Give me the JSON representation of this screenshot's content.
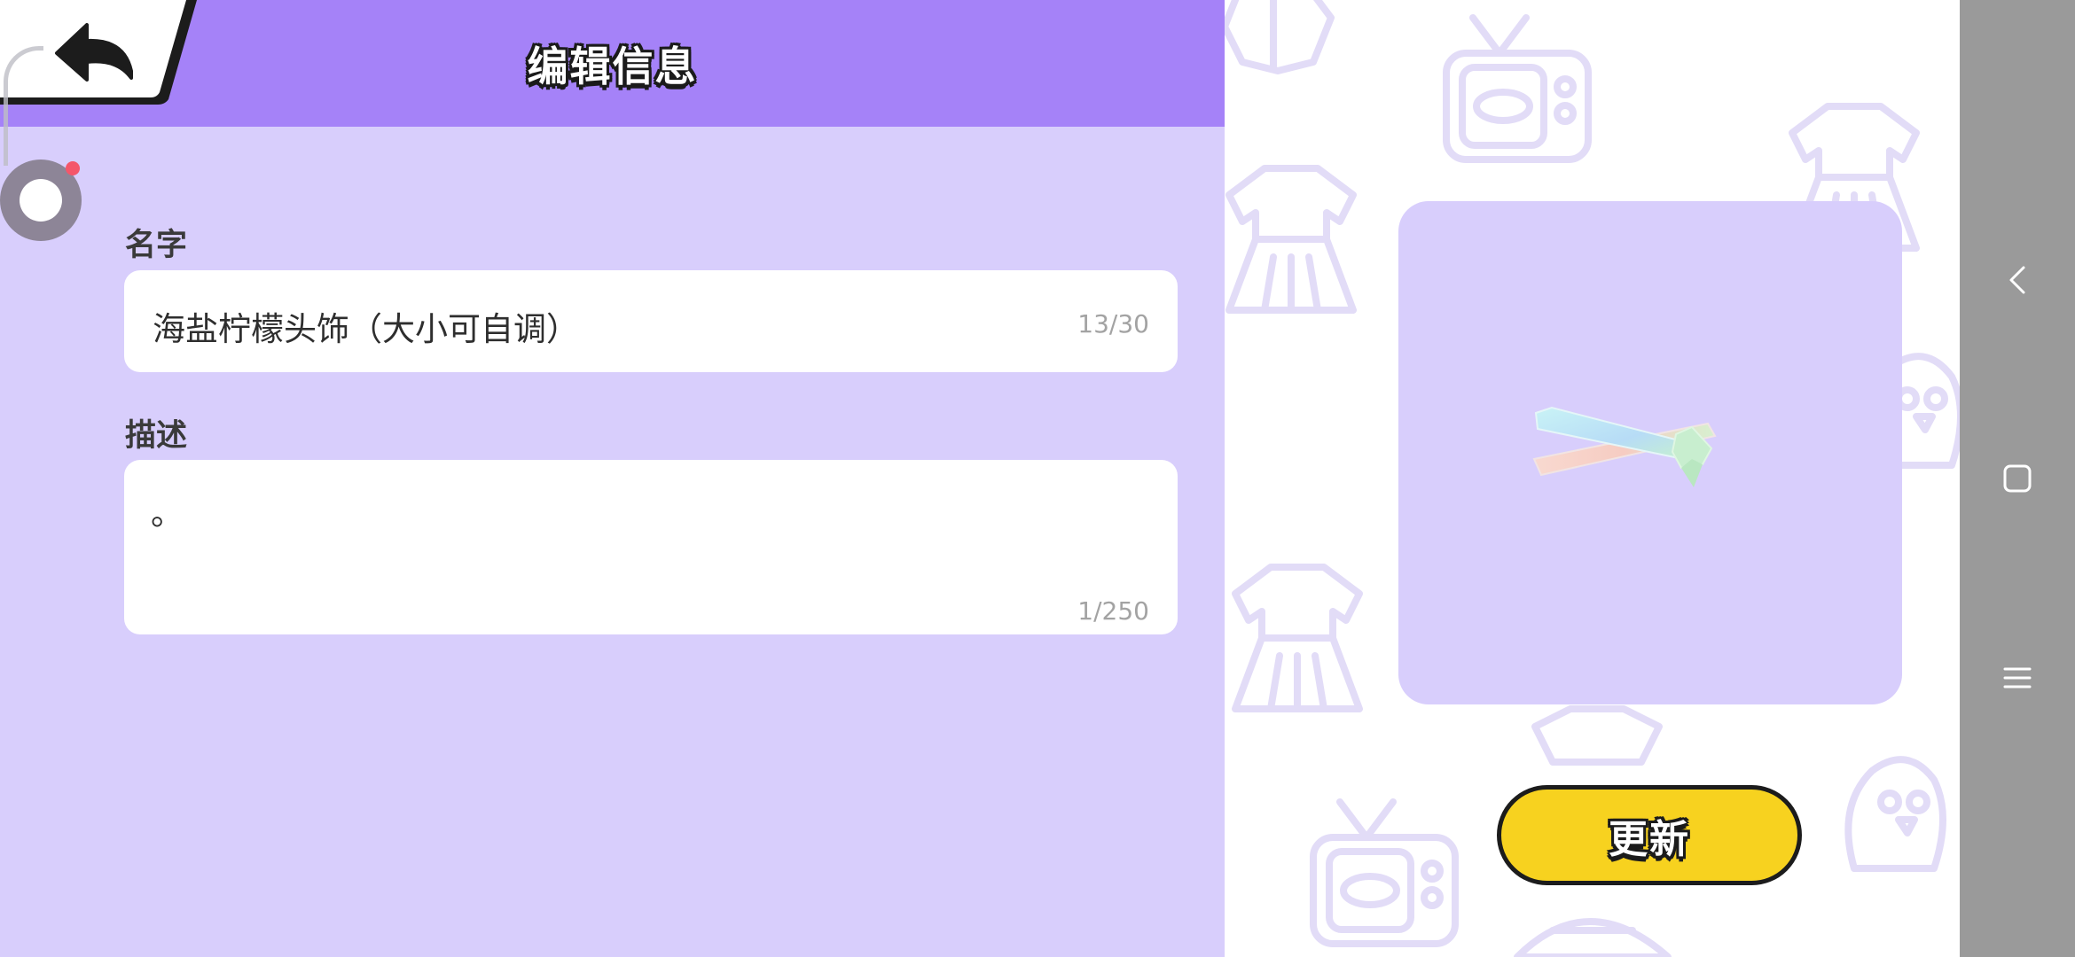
{
  "header": {
    "title": "编辑信息",
    "back_icon": "back-arrow-icon"
  },
  "form": {
    "name": {
      "label": "名字",
      "value": "海盐柠檬头饰（大小可自调）",
      "counter": "13/30"
    },
    "description": {
      "label": "描述",
      "value": "。",
      "counter": "1/250"
    }
  },
  "preview": {
    "item_icon": "hair-clip-icon"
  },
  "actions": {
    "update_label": "更新"
  },
  "system_nav": {
    "back_icon": "nav-back-icon",
    "home_icon": "nav-home-icon",
    "menu_icon": "nav-menu-icon"
  },
  "colors": {
    "header": "#a582f8",
    "panel": "#d8cefc",
    "button": "#f7d21f",
    "doodle": "#e4def8"
  }
}
